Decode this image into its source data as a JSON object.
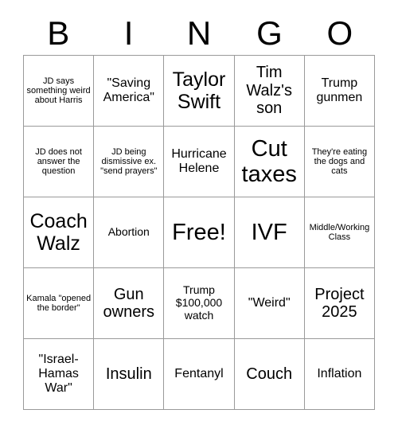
{
  "card": {
    "title": "BINGO",
    "header_letters": [
      "B",
      "I",
      "N",
      "G",
      "O"
    ],
    "free_space_label": "Free!",
    "colors": {
      "text": "#000000",
      "grid_line": "#9a9a9a",
      "background": "#ffffff"
    },
    "grid": {
      "columns": 5,
      "rows": 5,
      "cells": [
        {
          "row": 1,
          "col": 1,
          "column_letter": "B",
          "text": "JD says something weird about Harris",
          "size": "xs",
          "free": false
        },
        {
          "row": 1,
          "col": 2,
          "column_letter": "I",
          "text": "\"Saving America\"",
          "size": "m",
          "free": false
        },
        {
          "row": 1,
          "col": 3,
          "column_letter": "N",
          "text": "Taylor Swift",
          "size": "xl",
          "free": false
        },
        {
          "row": 1,
          "col": 4,
          "column_letter": "G",
          "text": "Tim Walz's son",
          "size": "l",
          "free": false
        },
        {
          "row": 1,
          "col": 5,
          "column_letter": "O",
          "text": "Trump gunmen",
          "size": "m",
          "free": false
        },
        {
          "row": 2,
          "col": 1,
          "column_letter": "B",
          "text": "JD does not answer the question",
          "size": "xs",
          "free": false
        },
        {
          "row": 2,
          "col": 2,
          "column_letter": "I",
          "text": "JD being dismissive ex. \"send prayers\"",
          "size": "xs",
          "free": false
        },
        {
          "row": 2,
          "col": 3,
          "column_letter": "N",
          "text": "Hurricane Helene",
          "size": "m",
          "free": false
        },
        {
          "row": 2,
          "col": 4,
          "column_letter": "G",
          "text": "Cut taxes",
          "size": "xxl",
          "free": false
        },
        {
          "row": 2,
          "col": 5,
          "column_letter": "O",
          "text": "They're eating the dogs and cats",
          "size": "xs",
          "free": false
        },
        {
          "row": 3,
          "col": 1,
          "column_letter": "B",
          "text": "Coach Walz",
          "size": "xl",
          "free": false
        },
        {
          "row": 3,
          "col": 2,
          "column_letter": "I",
          "text": "Abortion",
          "size": "s",
          "free": false
        },
        {
          "row": 3,
          "col": 3,
          "column_letter": "N",
          "text": "Free!",
          "size": "xxl",
          "free": true
        },
        {
          "row": 3,
          "col": 4,
          "column_letter": "G",
          "text": "IVF",
          "size": "xxl",
          "free": false
        },
        {
          "row": 3,
          "col": 5,
          "column_letter": "O",
          "text": "Middle/Working Class",
          "size": "xs",
          "free": false
        },
        {
          "row": 4,
          "col": 1,
          "column_letter": "B",
          "text": "Kamala \"opened the border\"",
          "size": "xs",
          "free": false
        },
        {
          "row": 4,
          "col": 2,
          "column_letter": "I",
          "text": "Gun owners",
          "size": "l",
          "free": false
        },
        {
          "row": 4,
          "col": 3,
          "column_letter": "N",
          "text": "Trump $100,000 watch",
          "size": "s",
          "free": false
        },
        {
          "row": 4,
          "col": 4,
          "column_letter": "G",
          "text": "\"Weird\"",
          "size": "m",
          "free": false
        },
        {
          "row": 4,
          "col": 5,
          "column_letter": "O",
          "text": "Project 2025",
          "size": "l",
          "free": false
        },
        {
          "row": 5,
          "col": 1,
          "column_letter": "B",
          "text": "\"Israel-Hamas War\"",
          "size": "m",
          "free": false
        },
        {
          "row": 5,
          "col": 2,
          "column_letter": "I",
          "text": "Insulin",
          "size": "l",
          "free": false
        },
        {
          "row": 5,
          "col": 3,
          "column_letter": "N",
          "text": "Fentanyl",
          "size": "m",
          "free": false
        },
        {
          "row": 5,
          "col": 4,
          "column_letter": "G",
          "text": "Couch",
          "size": "l",
          "free": false
        },
        {
          "row": 5,
          "col": 5,
          "column_letter": "O",
          "text": "Inflation",
          "size": "m",
          "free": false
        }
      ]
    }
  }
}
